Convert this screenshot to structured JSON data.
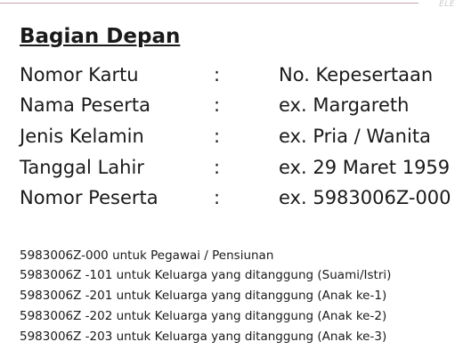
{
  "header": {
    "corner_label": "ELE"
  },
  "title": "Bagian Depan",
  "fields": [
    {
      "label": "Nomor Kartu",
      "separator": ":",
      "value": "No. Kepesertaan"
    },
    {
      "label": "Nama Peserta",
      "separator": ":",
      "value": "ex. Margareth"
    },
    {
      "label": "Jenis Kelamin",
      "separator": ":",
      "value": "ex. Pria / Wanita"
    },
    {
      "label": "Tanggal Lahir",
      "separator": ":",
      "value": "ex. 29 Maret 1959"
    },
    {
      "label": "Nomor Peserta",
      "separator": ":",
      "value": "ex. 5983006Z-000"
    }
  ],
  "notes": [
    "5983006Z-000 untuk Pegawai / Pensiunan",
    "5983006Z -101 untuk Keluarga yang ditanggung (Suami/Istri)",
    "5983006Z -201 untuk Keluarga yang ditanggung (Anak ke-1)",
    "5983006Z -202 untuk Keluarga yang ditanggung (Anak ke-2)",
    "5983006Z -203 untuk Keluarga yang ditanggung (Anak ke-3)"
  ]
}
